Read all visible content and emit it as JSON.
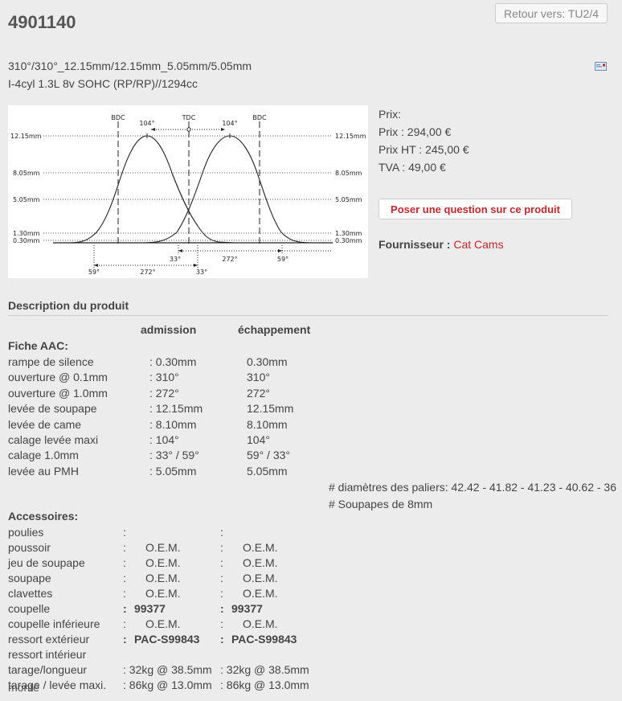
{
  "header": {
    "title": "4901140",
    "back_label": "Retour vers: TU2/4"
  },
  "summary": {
    "line1": "310°/310°_12.15mm/12.15mm_5.05mm/5.05mm",
    "line2": "I-4cyl 1.3L 8v SOHC (RP/RP)//1294cc"
  },
  "diagram": {
    "top_labels": [
      "BDC",
      "TDC",
      "BDC"
    ],
    "peak_angle_left": "104°",
    "peak_angle_right": "104°",
    "levels": [
      "12.15mm",
      "8.05mm",
      "5.05mm",
      "1.30mm",
      "0.30mm"
    ],
    "bottom_upper": [
      "33°",
      "272°",
      "59°"
    ],
    "bottom_lower": [
      "59°",
      "272°",
      "33°"
    ]
  },
  "pricing": {
    "label": "Prix:",
    "prix": "Prix : 294,00 €",
    "prix_ht": "Prix HT : 245,00 €",
    "tva": "TVA : 49,00 €"
  },
  "ask_button": "Poser une question sur ce produit",
  "supplier": {
    "label": "Fournisseur :",
    "name": "Cat Cams"
  },
  "description": {
    "heading": "Description du produit",
    "col_admission": "admission",
    "col_exhaust": "échappement",
    "fiche_title": "Fiche AAC:",
    "rows": [
      {
        "label": "rampe de silence",
        "adm": ": 0.30mm",
        "ech": "0.30mm"
      },
      {
        "label": "ouverture @ 0.1mm",
        "adm": ": 310°",
        "ech": "310°"
      },
      {
        "label": "ouverture @ 1.0mm",
        "adm": ": 272°",
        "ech": "272°"
      },
      {
        "label": "levée de soupape",
        "adm": ": 12.15mm",
        "ech": "12.15mm"
      },
      {
        "label": "levée de came",
        "adm": ": 8.10mm",
        "ech": "8.10mm"
      },
      {
        "label": "calage levée maxi",
        "adm": ": 104°",
        "ech": "104°"
      },
      {
        "label": "calage 1.0mm",
        "adm": ": 33° / 59°",
        "ech": "59° / 33°"
      },
      {
        "label": "levée au PMH",
        "adm": ": 5.05mm",
        "ech": "5.05mm"
      }
    ],
    "note1": "# diamètres des paliers: 42.42 - 41.82 - 41.23 - 40.62 - 36",
    "note2": "# Soupapes de 8mm",
    "acc_title": "Accessoires:",
    "acc_rows": [
      {
        "label": "poulies",
        "c1": ":",
        "adm": "",
        "c2": ":",
        "ech": ""
      },
      {
        "label": "poussoir",
        "c1": ":",
        "adm": "O.E.M.",
        "c2": ":",
        "ech": "O.E.M."
      },
      {
        "label": "jeu de soupape",
        "c1": ":",
        "adm": "O.E.M.",
        "c2": ":",
        "ech": "O.E.M."
      },
      {
        "label": "soupape",
        "c1": ":",
        "adm": "O.E.M.",
        "c2": ":",
        "ech": "O.E.M."
      },
      {
        "label": "clavettes",
        "c1": ":",
        "adm": "O.E.M.",
        "c2": ":",
        "ech": "O.E.M."
      },
      {
        "label": "coupelle",
        "c1": ":",
        "adm": "99377",
        "c2": ":",
        "ech": "99377"
      },
      {
        "label": "coupelle inférieure",
        "c1": ":",
        "adm": "O.E.M.",
        "c2": ":",
        "ech": "O.E.M."
      },
      {
        "label": "ressort extérieur",
        "c1": ":",
        "adm": "PAC-S99843",
        "c2": ":",
        "ech": "PAC-S99843"
      },
      {
        "label": "ressort intérieur",
        "c1": "",
        "adm": "",
        "c2": "",
        "ech": ""
      }
    ],
    "tarage1": {
      "label": "tarage/longueur",
      "adm": ": 32kg @ 38.5mm",
      "ech": ": 32kg @ 38.5mm"
    },
    "tarage2": {
      "label": "tarage / levée maxi.",
      "adm": ": 86kg @ 13.0mm",
      "ech": ": 86kg @ 13.0mm"
    },
    "footer_overlap": "monté"
  }
}
